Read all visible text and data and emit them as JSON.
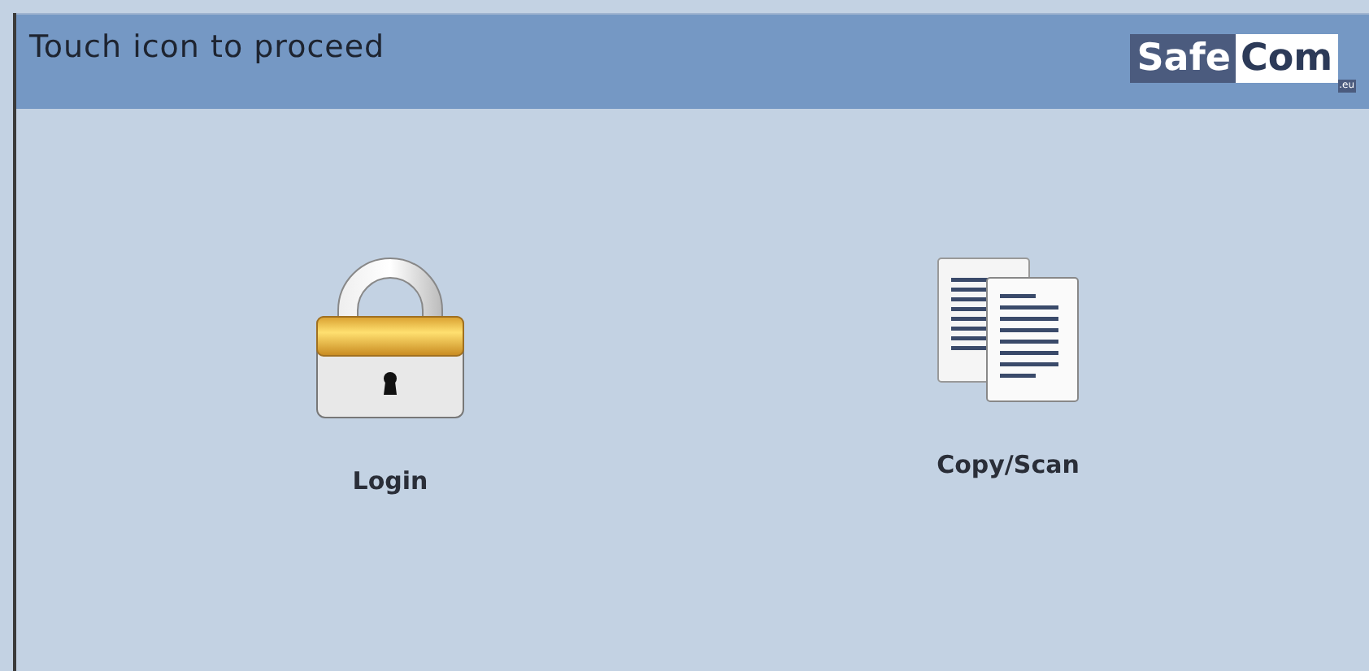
{
  "header": {
    "title": "Touch icon to proceed",
    "logo": {
      "part_1": "Safe",
      "part_2": "Com",
      "suffix": ".eu"
    }
  },
  "items": [
    {
      "kind": "lock",
      "label": "Login"
    },
    {
      "kind": "documents",
      "label": "Copy/Scan"
    }
  ]
}
